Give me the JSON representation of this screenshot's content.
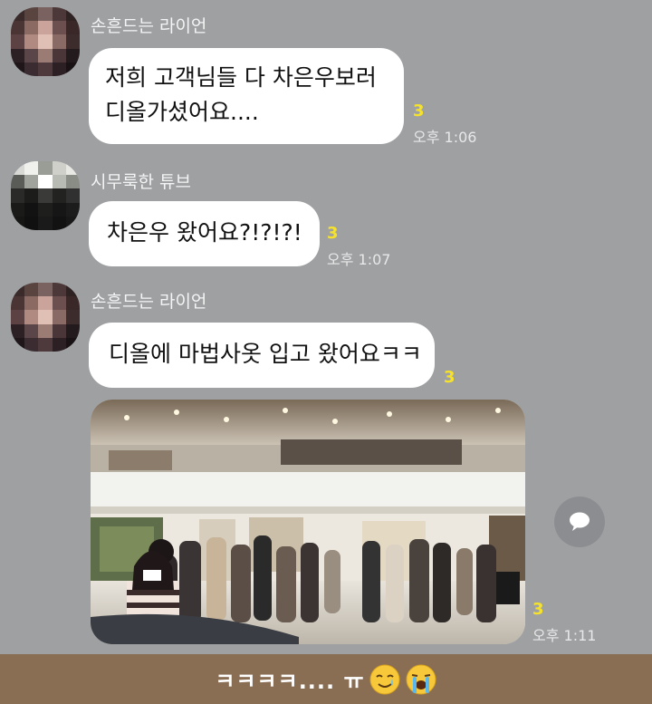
{
  "colors": {
    "chat_background": "#9ea0a2",
    "bubble": "#ffffff",
    "unread": "#f6e22b",
    "caption_bar": "#8a6e54"
  },
  "messages": [
    {
      "sender": "손흔드는 라이언",
      "lines": [
        "저희 고객님들 다 차은우보러",
        "디올가셨어요...."
      ],
      "unread": "3",
      "time": "오후 1:06"
    },
    {
      "sender": "시무룩한 튜브",
      "lines": [
        "차은우 왔어요?!?!?!"
      ],
      "unread": "3",
      "time": "오후 1:07"
    },
    {
      "sender": "손흔드는 라이언",
      "lines": [
        "디올에 마법사옷 입고 왔어요ㅋㅋ"
      ],
      "unread": "3",
      "time": ""
    }
  ],
  "photo_message": {
    "unread": "3",
    "time": "오후 1:11",
    "share_icon": "speech-bubble-icon"
  },
  "caption": {
    "text": "ㅋㅋㅋㅋ.... ㅠ",
    "emoji_1": "smiling-face-with-tear",
    "emoji_2": "loudly-crying-face"
  }
}
